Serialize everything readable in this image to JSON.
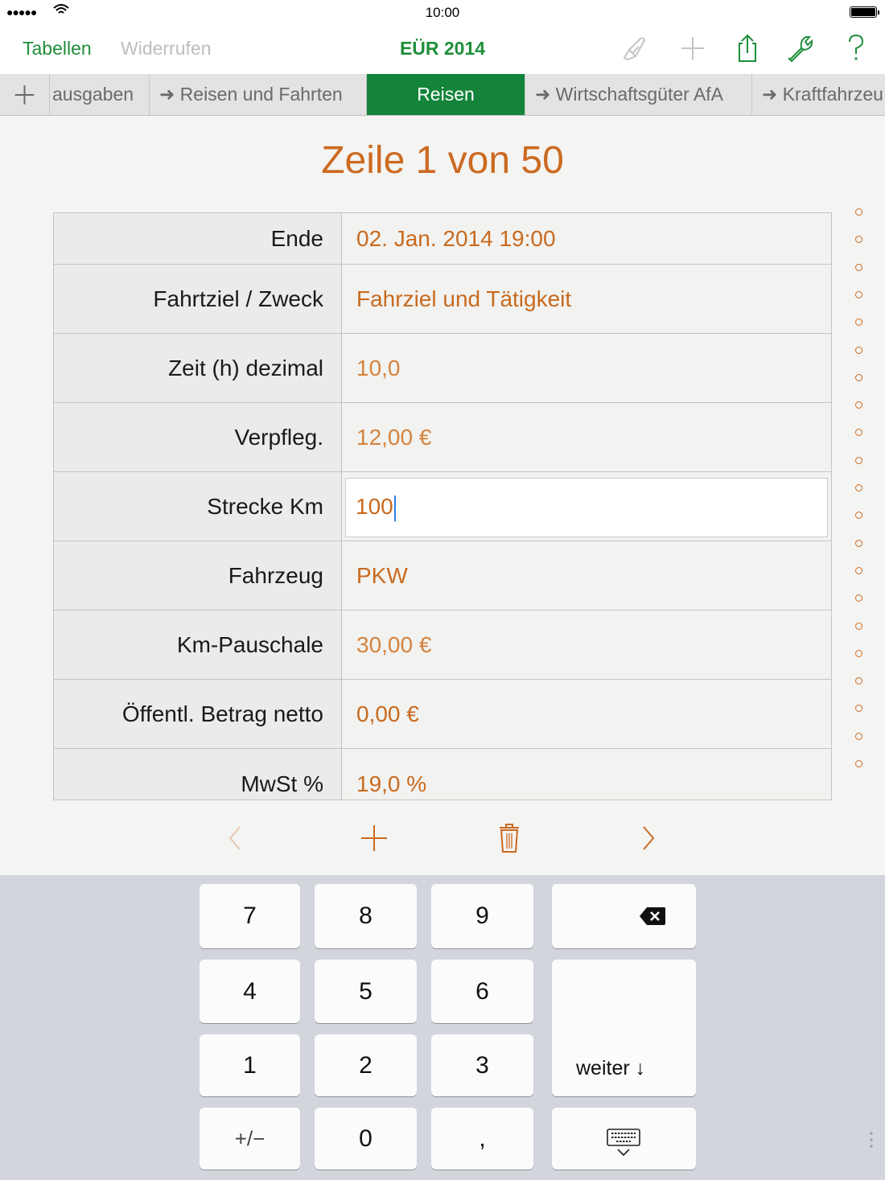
{
  "status": {
    "signal": "●●●●●",
    "time": "10:00"
  },
  "toolbar": {
    "tables_label": "Tabellen",
    "undo_label": "Widerrufen",
    "title": "EÜR 2014"
  },
  "tabs": [
    {
      "label": "ausgaben"
    },
    {
      "label": "➜ Reisen und Fahrten"
    },
    {
      "label": "Reisen"
    },
    {
      "label": "➜ Wirtschaftsgüter AfA"
    },
    {
      "label": "➜ Kraftfahrzeu"
    }
  ],
  "form": {
    "title": "Zeile 1 von 50",
    "rows": [
      {
        "label": "Ende",
        "value": "02. Jan. 2014  19:00"
      },
      {
        "label": "Fahrtziel / Zweck",
        "value": "Fahrziel und Tätigkeit"
      },
      {
        "label": "Zeit (h) dezimal",
        "value": "10,0"
      },
      {
        "label": "Verpfleg.",
        "value": "12,00 €"
      },
      {
        "label": "Strecke Km",
        "value": "100"
      },
      {
        "label": "Fahrzeug",
        "value": "PKW"
      },
      {
        "label": "Km-Pauschale",
        "value": "30,00 €"
      },
      {
        "label": "Öffentl. Betrag netto",
        "value": "0,00 €"
      },
      {
        "label": "MwSt %",
        "value": "19,0 %"
      }
    ]
  },
  "keyboard": {
    "k7": "7",
    "k8": "8",
    "k9": "9",
    "k4": "4",
    "k5": "5",
    "k6": "6",
    "k1": "1",
    "k2": "2",
    "k3": "3",
    "sign": "+/−",
    "k0": "0",
    "comma": ",",
    "next": "weiter ↓"
  },
  "colors": {
    "accent_green": "#1f8f3b",
    "active_tab": "#13843a",
    "value_orange": "#c86a1f"
  },
  "icons": [
    "paintbrush-icon",
    "plus-icon",
    "share-icon",
    "wrench-icon",
    "help-icon",
    "delete-key-icon",
    "keyboard-hide-icon",
    "trash-icon",
    "chevron-left-icon",
    "chevron-right-icon"
  ]
}
